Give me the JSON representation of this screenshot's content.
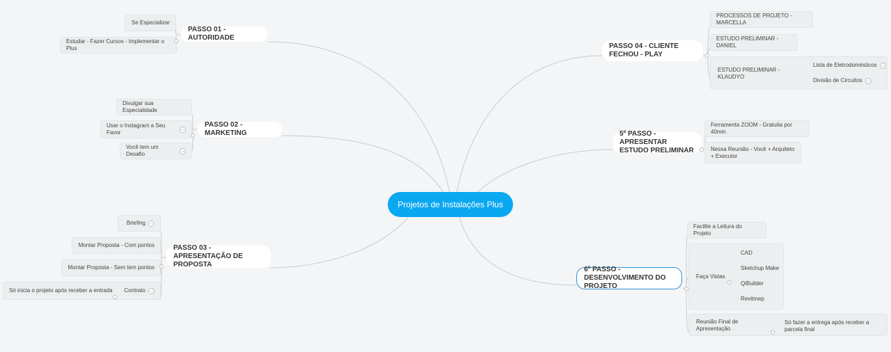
{
  "central": {
    "label": "Projetos de Instalações Plus"
  },
  "colors": {
    "central": "#0aa8f0",
    "line": "#c8ccce",
    "selected_border": "#2f95d6"
  },
  "branches": {
    "passo01": {
      "title": "PASSO 01 - AUTORIDADE",
      "items": [
        "Se Especializar",
        "Estudar - Fazer Cursos - Implementar o Plus"
      ]
    },
    "passo02": {
      "title": "PASSO 02 - MARKETING",
      "items": [
        "Divulgar sua Especialidade",
        "Usar o Instagram a Seu Favor",
        "Você tem um Desafio"
      ]
    },
    "passo03": {
      "title": "PASSO 03 - APRESENTAÇÃO DE PROPOSTA",
      "items": [
        "Briefing",
        "Montar Proposta - Com pontos",
        "Montar Proposta - Sem tem pontos",
        "Contrato"
      ],
      "contrato_child": "Só inicia o projeto após receber a entrada"
    },
    "passo04": {
      "title": "PASSO 04 - CLIENTE FECHOU - PLAY",
      "items": [
        "PROCESSOS DE PROJETO - MARCELLA",
        "ESTUDO PRELIMINAR - DANIEL",
        "ESTUDO PRELIMINAR - KLAUDYO"
      ],
      "klaudyo_children": [
        "Lista de Eletrodomésticos",
        "Divisão de Circuitos"
      ]
    },
    "passo05": {
      "title": "5º PASSO - APRESENTAR ESTUDO PRELIMINAR",
      "items": [
        "Ferramenta ZOOM - Gratuita por 40min",
        "Nessa Reunião - Você + Arquiteto + Executor"
      ]
    },
    "passo06": {
      "title": "6º PASSO - DESENVOLVIMENTO DO PROJETO",
      "items": [
        "Facilite a Leitura do Projeto",
        "Faça Vistas",
        "Reunião Final de Apresentação"
      ],
      "vistas_children": [
        "CAD",
        "Sketchup Make",
        "QiBuilder",
        "Revitmep"
      ],
      "reuniao_child": "Só fazer a entrega após receber a parcela final"
    }
  }
}
